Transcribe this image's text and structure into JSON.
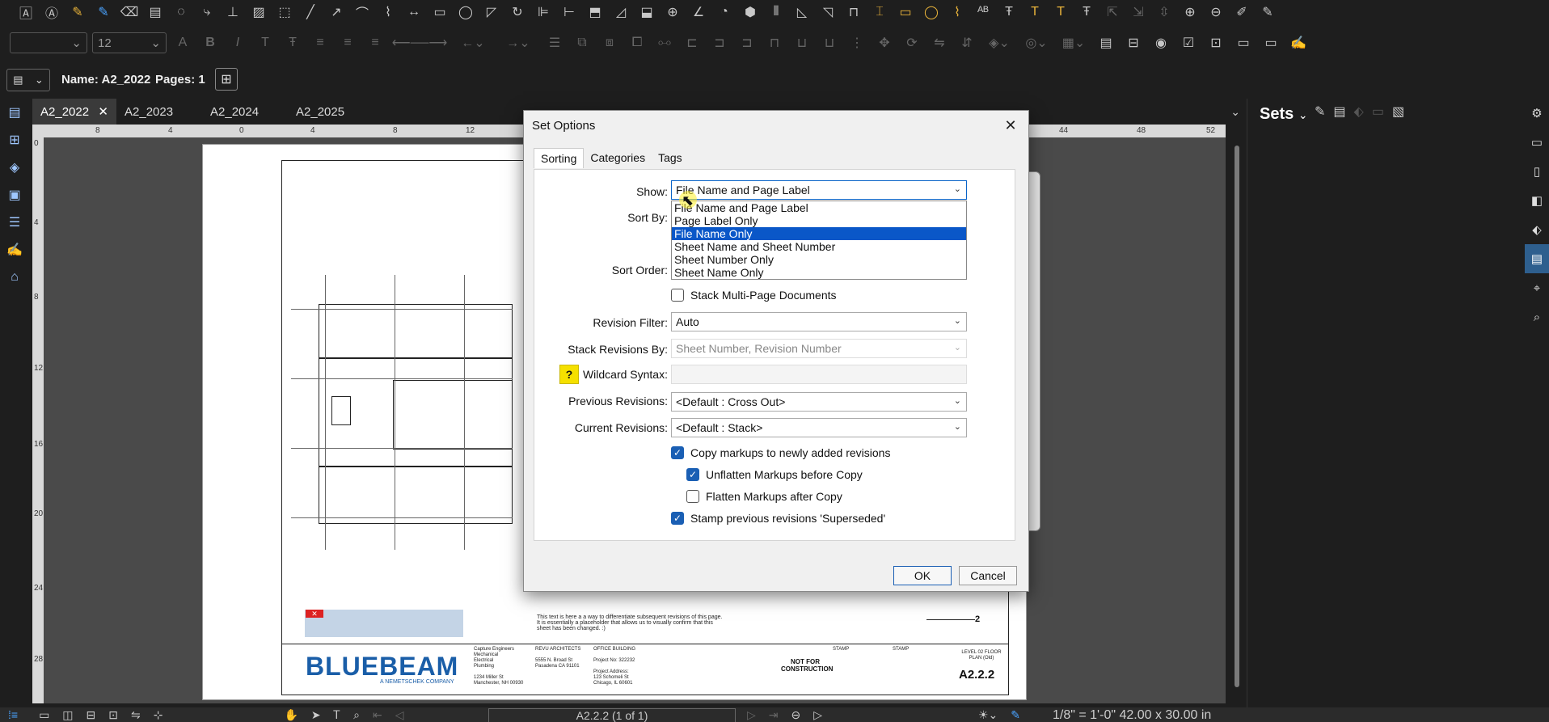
{
  "toolbar2": {
    "font_name": "",
    "font_size": "12"
  },
  "namebar": {
    "name_label": "Name:",
    "name_value": "A2_2022",
    "pages_label": "Pages:",
    "pages_value": "1"
  },
  "tabs": [
    {
      "label": "A2_2022",
      "active": true
    },
    {
      "label": "A2_2023",
      "active": false
    },
    {
      "label": "A2_2024",
      "active": false
    },
    {
      "label": "A2_2025",
      "active": false
    }
  ],
  "ruler_ticks": [
    "8",
    "4",
    "0",
    "4",
    "8",
    "12",
    "44",
    "48",
    "52"
  ],
  "vruler_ticks": [
    "0",
    "4",
    "8",
    "12",
    "16",
    "20",
    "24",
    "28"
  ],
  "sets_panel": {
    "title": "Sets"
  },
  "sheet": {
    "logo": "BLUEBEAM",
    "logo_sub": "A NEMETSCHEK COMPANY",
    "engineers": "Capture Engineers\nMechanical\nElectrical\nPlumbing\n\n1234 Miller St\nManchester, NH 00930",
    "architects": "REVU ARCHITECTS\n\n5555 N. Broad St\nPasadena CA 91101",
    "project": "OFFICE BUILDING\n\nProject No: 322232\n\nProject Address:\n123 Schomeli St\nChicago, IL 60601",
    "not_for": "NOT FOR CONSTRUCTION",
    "stamp1": "STAMP",
    "stamp2": "STAMP",
    "level_title": "LEVEL 02 FLOOR PLAN (Old)",
    "sheet_number": "A2.2.2",
    "callout": "2",
    "note": "This text is here a a way to differentiate subsequent revisions of this page. It is essentially a placeholder that allows us to visually confirm that this sheet has been changed. :)"
  },
  "dialog": {
    "title": "Set Options",
    "tabs": [
      "Sorting",
      "Categories",
      "Tags"
    ],
    "show_label": "Show:",
    "show_value": "File Name and Page Label",
    "show_options": [
      "File Name and Page Label",
      "Page Label Only",
      "File Name Only",
      "Sheet Name and Sheet Number",
      "Sheet Number Only",
      "Sheet Name Only"
    ],
    "show_highlighted": 2,
    "sort_by_label": "Sort By:",
    "sort_order_label": "Sort Order:",
    "stack_multi": {
      "label": "Stack Multi-Page Documents",
      "checked": false
    },
    "revision_filter_label": "Revision Filter:",
    "revision_filter_value": "Auto",
    "stack_revisions_label": "Stack Revisions By:",
    "stack_revisions_value": "Sheet Number, Revision Number",
    "wildcard_label": "Wildcard Syntax:",
    "wildcard_help": "?",
    "wildcard_value": "",
    "previous_revisions_label": "Previous Revisions:",
    "previous_revisions_value": "<Default : Cross Out>",
    "current_revisions_label": "Current Revisions:",
    "current_revisions_value": "<Default : Stack>",
    "copy_markups": {
      "label": "Copy markups to newly added revisions",
      "checked": true
    },
    "unflatten": {
      "label": "Unflatten Markups before Copy",
      "checked": true
    },
    "flatten_after": {
      "label": "Flatten Markups after Copy",
      "checked": false
    },
    "stamp_prev": {
      "label": "Stamp previous revisions 'Superseded'",
      "checked": true
    },
    "ok_label": "OK",
    "cancel_label": "Cancel"
  },
  "statusbar": {
    "page_indicator": "A2.2.2 (1 of 1)",
    "scale": "1/8\" = 1'-0\"    42.00 x 30.00 in"
  }
}
